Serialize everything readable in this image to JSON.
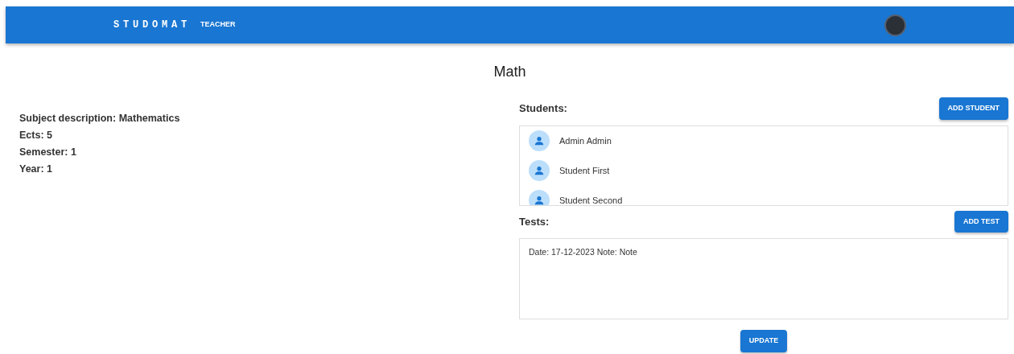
{
  "app_bar": {
    "brand": "STUDOMAT",
    "nav_link": "TEACHER"
  },
  "title": "Math",
  "details": [
    "Subject description: Mathematics",
    "Ects: 5",
    "Semester: 1",
    "Year: 1"
  ],
  "students": {
    "heading": "Students:",
    "add_button": "ADD STUDENT",
    "items": [
      {
        "name": "Admin Admin"
      },
      {
        "name": "Student First"
      },
      {
        "name": "Student Second"
      }
    ]
  },
  "tests": {
    "heading": "Tests:",
    "add_button": "ADD TEST",
    "items": [
      "Date: 17-12-2023 Note: Note"
    ]
  },
  "update_button": "UPDATE"
}
